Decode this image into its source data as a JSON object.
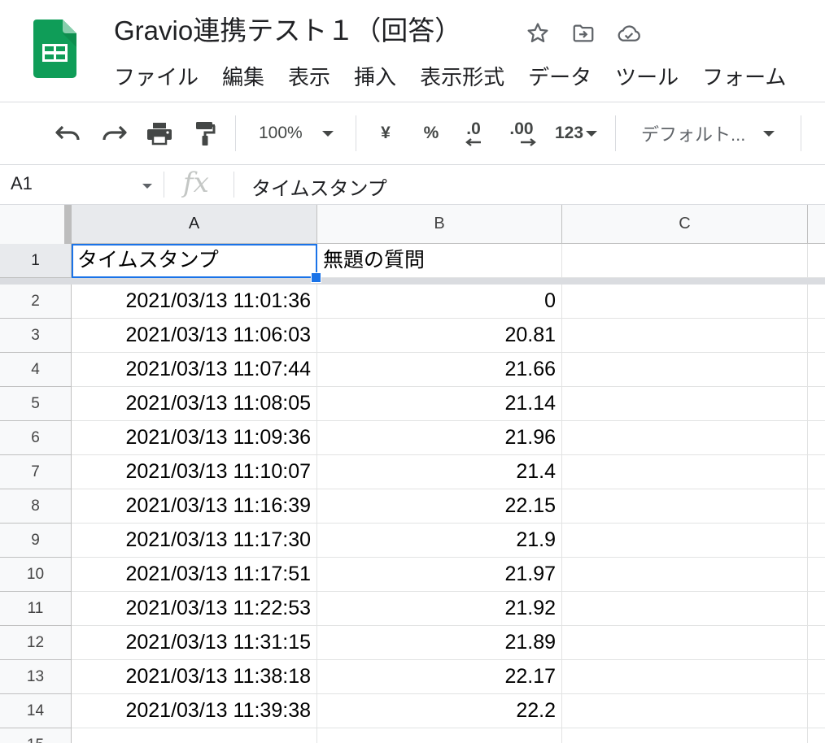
{
  "doc": {
    "title": "Gravio連携テスト１（回答）"
  },
  "menu": [
    "ファイル",
    "編集",
    "表示",
    "挿入",
    "表示形式",
    "データ",
    "ツール",
    "フォーム"
  ],
  "toolbar": {
    "zoom": "100%",
    "currency": "¥",
    "percent": "%",
    "decrease_decimal": ".0",
    "increase_decimal": ".00",
    "more_formats": "123",
    "font": "デフォルト..."
  },
  "formula_bar": {
    "cell_ref": "A1",
    "fx": "fx",
    "content": "タイムスタンプ"
  },
  "sheet": {
    "columns": [
      "A",
      "B",
      "C"
    ],
    "rows": [
      {
        "num": "1",
        "a": "タイムスタンプ",
        "b": "無題の質問"
      },
      {
        "num": "2",
        "a": "2021/03/13 11:01:36",
        "b": "0"
      },
      {
        "num": "3",
        "a": "2021/03/13 11:06:03",
        "b": "20.81"
      },
      {
        "num": "4",
        "a": "2021/03/13 11:07:44",
        "b": "21.66"
      },
      {
        "num": "5",
        "a": "2021/03/13 11:08:05",
        "b": "21.14"
      },
      {
        "num": "6",
        "a": "2021/03/13 11:09:36",
        "b": "21.96"
      },
      {
        "num": "7",
        "a": "2021/03/13 11:10:07",
        "b": "21.4"
      },
      {
        "num": "8",
        "a": "2021/03/13 11:16:39",
        "b": "22.15"
      },
      {
        "num": "9",
        "a": "2021/03/13 11:17:30",
        "b": "21.9"
      },
      {
        "num": "10",
        "a": "2021/03/13 11:17:51",
        "b": "21.97"
      },
      {
        "num": "11",
        "a": "2021/03/13 11:22:53",
        "b": "21.92"
      },
      {
        "num": "12",
        "a": "2021/03/13 11:31:15",
        "b": "21.89"
      },
      {
        "num": "13",
        "a": "2021/03/13 11:38:18",
        "b": "22.17"
      },
      {
        "num": "14",
        "a": "2021/03/13 11:39:38",
        "b": "22.2"
      },
      {
        "num": "15",
        "a": "",
        "b": ""
      }
    ]
  },
  "colors": {
    "accent": "#1a73e8",
    "sheets_green": "#0f9d58"
  },
  "icons": {
    "title": [
      "star-icon",
      "move-to-folder-icon",
      "cloud-saved-icon"
    ],
    "toolbar": [
      "undo-icon",
      "redo-icon",
      "print-icon",
      "paint-format-icon"
    ]
  }
}
